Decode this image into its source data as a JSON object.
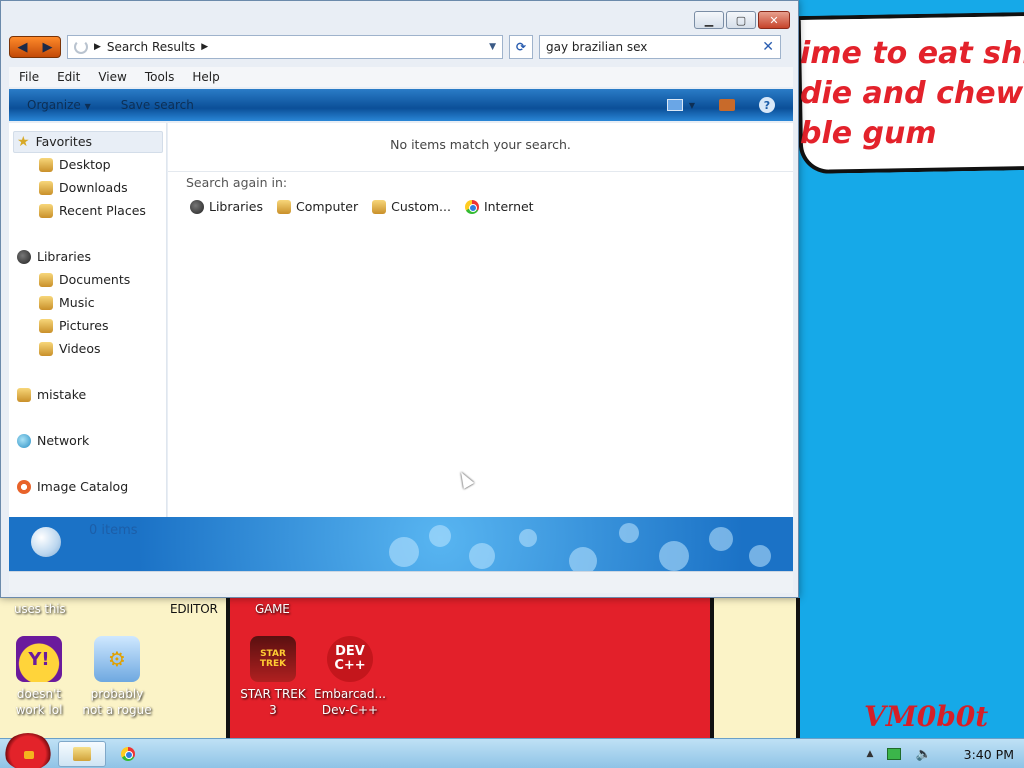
{
  "window": {
    "address": "Search Results",
    "search_query": "gay brazilian sex",
    "menu": [
      "File",
      "Edit",
      "View",
      "Tools",
      "Help"
    ],
    "toolbar": {
      "organize": "Organize",
      "save_search": "Save search"
    },
    "nav": {
      "favorites": "Favorites",
      "favorites_items": [
        "Desktop",
        "Downloads",
        "Recent Places"
      ],
      "libraries": "Libraries",
      "libraries_items": [
        "Documents",
        "Music",
        "Pictures",
        "Videos"
      ],
      "mistake": "mistake",
      "network": "Network",
      "image_catalog": "Image Catalog"
    },
    "content": {
      "no_items": "No items match your search.",
      "search_again": "Search again in:",
      "locations": [
        "Libraries",
        "Computer",
        "Custom...",
        "Internet"
      ]
    },
    "details": {
      "count": "0 items"
    }
  },
  "desktop": {
    "speech_lines": [
      "ime to eat shit",
      "die and chew",
      "ble gum"
    ],
    "labels": {
      "uses_this": "uses this",
      "editor": "EDIITOR",
      "game": "GAME",
      "signature": "VM0b0t"
    },
    "icons": [
      {
        "label_1": "doesn't",
        "label_2": "work lol"
      },
      {
        "label_1": "probably",
        "label_2": "not a rogue"
      },
      {
        "label_1": "STAR TREK",
        "label_2": "3"
      },
      {
        "label_1": "Embarcad...",
        "label_2": "Dev-C++"
      }
    ],
    "devcpp_logo": "DEV C++"
  },
  "taskbar": {
    "time": "3:40 PM"
  },
  "colors": {
    "accent": "#1b72c6",
    "wallpaper": "#16a9e8",
    "red": "#e3202a",
    "cream": "#fbf3c7"
  }
}
